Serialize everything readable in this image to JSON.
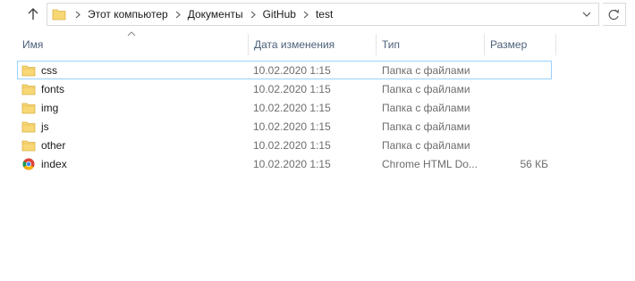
{
  "address_bar": {
    "breadcrumbs": [
      "Этот компьютер",
      "Документы",
      "GitHub",
      "test"
    ]
  },
  "columns": {
    "name": "Имя",
    "date": "Дата изменения",
    "type": "Тип",
    "size": "Размер"
  },
  "sort": {
    "column": "name",
    "direction": "ascending"
  },
  "files": [
    {
      "name": "css",
      "date": "10.02.2020 1:15",
      "type": "Папка с файлами",
      "size": "",
      "icon": "folder-icon"
    },
    {
      "name": "fonts",
      "date": "10.02.2020 1:15",
      "type": "Папка с файлами",
      "size": "",
      "icon": "folder-icon"
    },
    {
      "name": "img",
      "date": "10.02.2020 1:15",
      "type": "Папка с файлами",
      "size": "",
      "icon": "folder-icon"
    },
    {
      "name": "js",
      "date": "10.02.2020 1:15",
      "type": "Папка с файлами",
      "size": "",
      "icon": "folder-icon"
    },
    {
      "name": "other",
      "date": "10.02.2020 1:15",
      "type": "Папка с файлами",
      "size": "",
      "icon": "folder-icon"
    },
    {
      "name": "index",
      "date": "10.02.2020 1:15",
      "type": "Chrome HTML Do...",
      "size": "56 КБ",
      "icon": "chrome-icon"
    }
  ],
  "colors": {
    "header_text": "#4c607a",
    "focus_border": "#99d1ff",
    "folder_yellow": "#f8d775"
  }
}
